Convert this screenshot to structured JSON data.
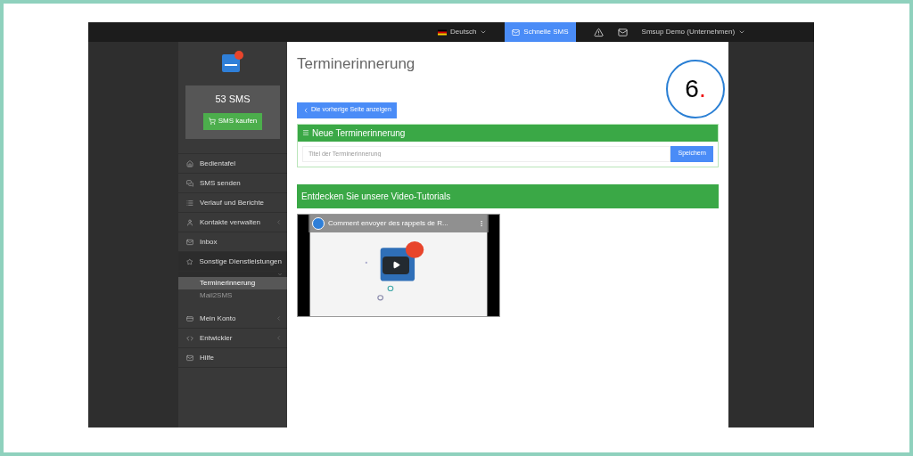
{
  "topbar": {
    "language": "Deutsch",
    "quick_sms": "Schnelle SMS",
    "account": "Smsup Demo (Unternehmen)"
  },
  "sidebar": {
    "balance": "53 SMS",
    "buy_button": "SMS kaufen",
    "items": [
      {
        "label": "Bedientafel",
        "kind": "link",
        "selected": false
      },
      {
        "label": "SMS senden",
        "kind": "link",
        "selected": false
      },
      {
        "label": "Verlauf und Berichte",
        "kind": "link",
        "selected": false
      },
      {
        "label": "Kontakte verwalten",
        "kind": "submenu",
        "expanded": false,
        "selected": false
      },
      {
        "label": "Inbox",
        "kind": "link",
        "selected": false
      },
      {
        "label": "Sonstige Dienstleistungen",
        "kind": "submenu",
        "expanded": true,
        "selected": true,
        "children": [
          {
            "label": "Terminerinnerung",
            "selected": true
          },
          {
            "label": "Mail2SMS",
            "selected": false
          }
        ]
      },
      {
        "label": "Mein Konto",
        "kind": "submenu",
        "expanded": false,
        "selected": false
      },
      {
        "label": "Entwickler",
        "kind": "submenu",
        "expanded": false,
        "selected": false
      },
      {
        "label": "Hilfe",
        "kind": "link",
        "selected": false
      }
    ]
  },
  "page": {
    "title": "Terminerinnerung",
    "step_badge": "6",
    "step_dot": ".",
    "back_button": "Die vorherige Seite anzeigen",
    "panel": {
      "title": "Neue Terminerinnerung",
      "placeholder": "Titel der Terminerinnerung",
      "save_button": "Speichern"
    },
    "tutorials": {
      "title": "Entdecken Sie unsere Video-Tutorials",
      "video_title": "Comment envoyer des rappels de R..."
    }
  }
}
